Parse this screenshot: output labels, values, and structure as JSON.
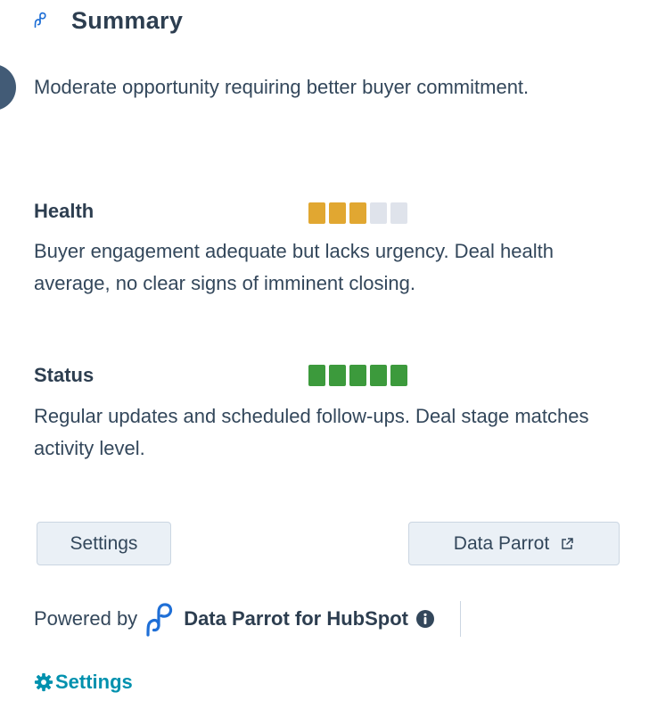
{
  "header": {
    "icon": "data-parrot-logo-icon",
    "title": "Summary"
  },
  "summary": {
    "text": "Moderate opportunity requiring better buyer commitment."
  },
  "health": {
    "label": "Health",
    "level": 3,
    "max": 5,
    "active_color": "#e1a731",
    "inactive_color": "#dfe3eb",
    "description": "Buyer engagement adequate but lacks urgency. Deal health average, no clear signs of imminent closing."
  },
  "status": {
    "label": "Status",
    "level": 5,
    "max": 5,
    "active_color": "#3c9a3c",
    "inactive_color": "#dfe3eb",
    "description": "Regular updates and scheduled follow-ups. Deal stage matches activity level."
  },
  "actions": {
    "settings_label": "Settings",
    "data_parrot_label": "Data Parrot",
    "data_parrot_icon": "external-link-icon"
  },
  "footer": {
    "powered_by": "Powered by",
    "brand": "Data Parrot for HubSpot",
    "info_icon": "info-icon",
    "settings_label": "Settings",
    "settings_icon": "gear-icon"
  },
  "colors": {
    "text": "#33475b",
    "heading": "#2d3e50",
    "link": "#0091ae",
    "brand_blue": "#1f6fd6",
    "button_bg": "#eaf0f6"
  }
}
